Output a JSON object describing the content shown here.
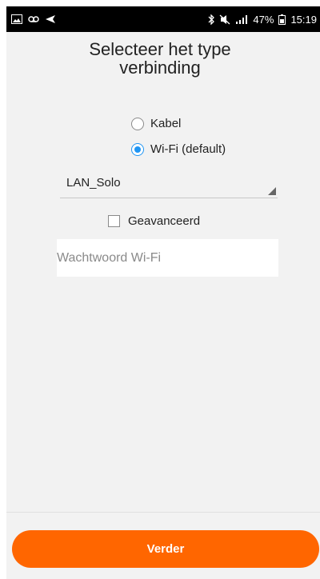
{
  "status_bar": {
    "icons_left": [
      "image-icon",
      "voicemail-icon",
      "send-icon"
    ],
    "icons_right": [
      "bluetooth-icon",
      "mute-icon",
      "signal-icon",
      "battery-icon"
    ],
    "battery": "47%",
    "time": "15:19"
  },
  "page": {
    "title": "Selecteer het type\nverbinding"
  },
  "connection": {
    "options": [
      {
        "label": "Kabel",
        "selected": false
      },
      {
        "label": "Wi-Fi (default)",
        "selected": true
      }
    ]
  },
  "network": {
    "selected": "LAN_Solo"
  },
  "advanced": {
    "label": "Geavanceerd",
    "checked": false
  },
  "password": {
    "placeholder": "Wachtwoord Wi-Fi",
    "value": ""
  },
  "footer": {
    "next_label": "Verder"
  },
  "colors": {
    "accent": "#ff6600",
    "radio_selected": "#2196f3"
  }
}
